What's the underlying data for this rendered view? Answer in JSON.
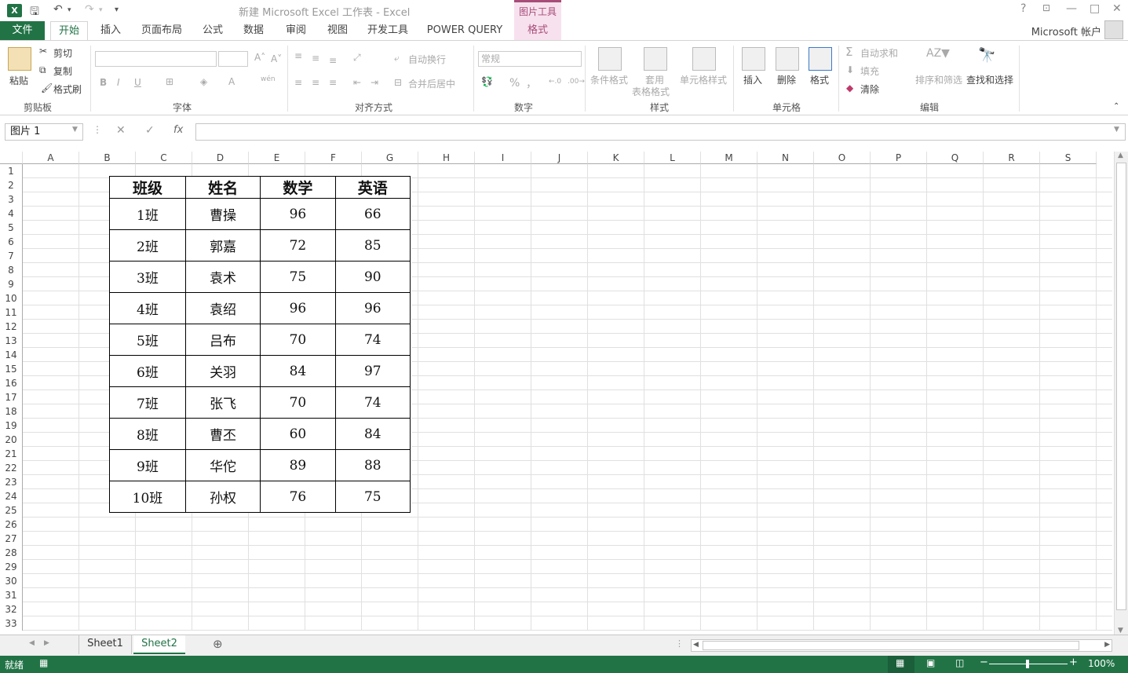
{
  "window": {
    "title": "新建 Microsoft Excel 工作表 - Excel",
    "contextual_group": "图片工具",
    "account": "Microsoft 帐户",
    "help": "?",
    "minimize": "—",
    "restore": "□",
    "close": "✕"
  },
  "tabs": {
    "file": "文件",
    "home": "开始",
    "insert": "插入",
    "page_layout": "页面布局",
    "formulas": "公式",
    "data": "数据",
    "review": "审阅",
    "view": "视图",
    "developer": "开发工具",
    "power_query": "POWER QUERY",
    "format": "格式"
  },
  "ribbon": {
    "clipboard": {
      "paste": "粘贴",
      "cut": "剪切",
      "copy": "复制",
      "format_painter": "格式刷",
      "label": "剪贴板"
    },
    "font": {
      "label": "字体",
      "bold": "B",
      "italic": "I",
      "underline": "U"
    },
    "alignment": {
      "wrap": "自动换行",
      "merge": "合并后居中",
      "label": "对齐方式"
    },
    "number": {
      "format": "常规",
      "percent": "%",
      "comma": "，",
      "label": "数字"
    },
    "styles": {
      "conditional": "条件格式",
      "table1": "套用",
      "table2": "表格格式",
      "cell_styles": "单元格样式",
      "label": "样式"
    },
    "cells": {
      "insert": "插入",
      "delete": "删除",
      "format": "格式",
      "label": "单元格"
    },
    "editing": {
      "autosum": "自动求和",
      "fill": "填充",
      "clear": "清除",
      "sort": "排序和筛选",
      "find": "查找和选择",
      "label": "编辑"
    }
  },
  "formula_bar": {
    "name_box": "图片 1",
    "fx": "fx",
    "value": ""
  },
  "columns": [
    "A",
    "B",
    "C",
    "D",
    "E",
    "F",
    "G",
    "H",
    "I",
    "J",
    "K",
    "L",
    "M",
    "N",
    "O",
    "P",
    "Q",
    "R",
    "S"
  ],
  "rows": [
    "1",
    "2",
    "3",
    "4",
    "5",
    "6",
    "7",
    "8",
    "9",
    "10",
    "11",
    "12",
    "13",
    "14",
    "15",
    "16",
    "17",
    "18",
    "19",
    "20",
    "21",
    "22",
    "23",
    "24",
    "25",
    "26",
    "27",
    "28",
    "29",
    "30",
    "31",
    "32",
    "33"
  ],
  "picture_table": {
    "headers": [
      "班级",
      "姓名",
      "数学",
      "英语"
    ],
    "rows": [
      [
        "1班",
        "曹操",
        "96",
        "66"
      ],
      [
        "2班",
        "郭嘉",
        "72",
        "85"
      ],
      [
        "3班",
        "袁术",
        "75",
        "90"
      ],
      [
        "4班",
        "袁绍",
        "96",
        "96"
      ],
      [
        "5班",
        "吕布",
        "70",
        "74"
      ],
      [
        "6班",
        "关羽",
        "84",
        "97"
      ],
      [
        "7班",
        "张飞",
        "70",
        "74"
      ],
      [
        "8班",
        "曹丕",
        "60",
        "84"
      ],
      [
        "9班",
        "华佗",
        "89",
        "88"
      ],
      [
        "10班",
        "孙权",
        "76",
        "75"
      ]
    ]
  },
  "sheets": [
    "Sheet1",
    "Sheet2"
  ],
  "status": {
    "ready": "就绪",
    "zoom": "100%"
  },
  "colors": {
    "excel_green": "#217346",
    "context_pink": "#a64d79"
  }
}
